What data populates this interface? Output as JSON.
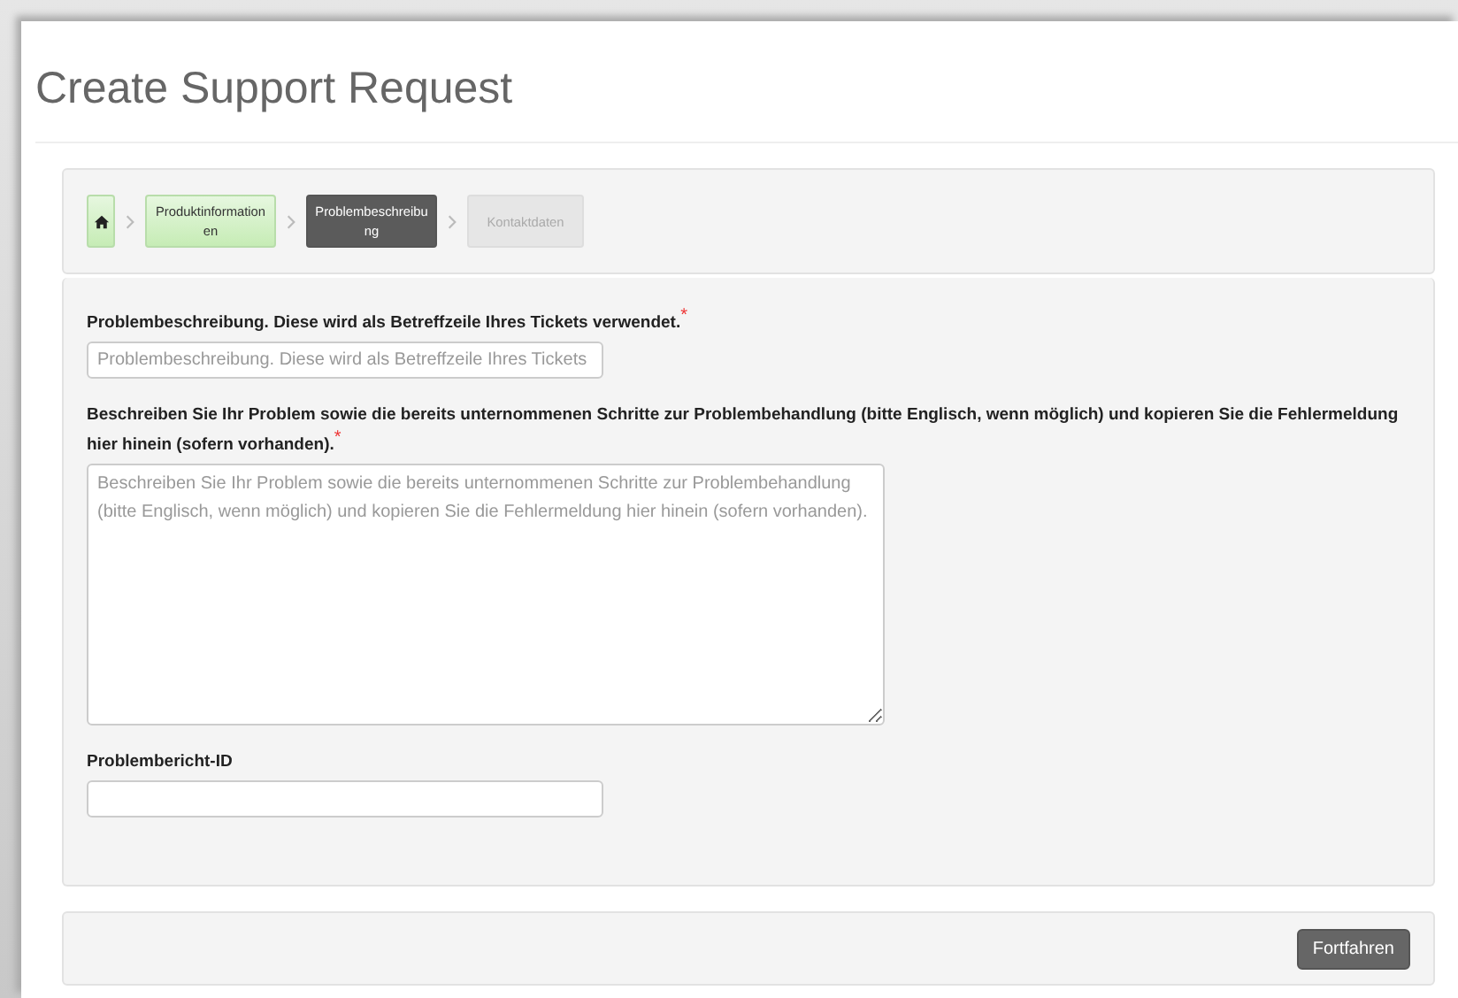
{
  "page": {
    "title": "Create Support Request"
  },
  "steps": [
    {
      "kind": "home",
      "completed": true,
      "selected": false
    },
    {
      "kind": "text",
      "label": "Produktinformationen",
      "completed": true,
      "selected": false
    },
    {
      "kind": "text",
      "label": "Problembeschreibung",
      "completed": false,
      "selected": true
    },
    {
      "kind": "text",
      "label": "Kontaktdaten",
      "completed": false,
      "selected": false
    }
  ],
  "fields": [
    {
      "kind": "input",
      "label": "Problembeschreibung. Diese wird als Betreffzeile Ihres Tickets verwendet.",
      "required_mark": "*",
      "placeholder": "Problembeschreibung. Diese wird als Betreffzeile Ihres Tickets"
    },
    {
      "kind": "textarea",
      "label": "Beschreiben Sie Ihr Problem sowie die bereits unternommenen Schritte zur Problembehandlung (bitte Englisch, wenn möglich) und kopieren Sie die Fehlermeldung hier hinein (sofern vorhanden).",
      "required_mark": "*",
      "placeholder": "Beschreiben Sie Ihr Problem sowie die bereits unternommenen Schritte zur Problembehandlung (bitte Englisch, wenn möglich) und kopieren Sie die Fehlermeldung hier hinein (sofern vorhanden)."
    },
    {
      "kind": "input",
      "label": "Problembericht-ID"
    }
  ],
  "footer": {
    "button": "Fortfahren"
  }
}
